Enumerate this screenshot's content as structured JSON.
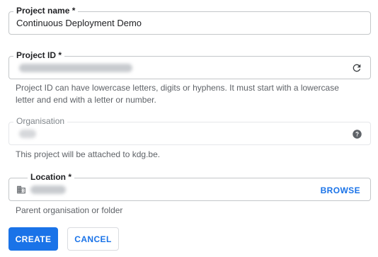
{
  "project_name": {
    "label": "Project name *",
    "value": "Continuous Deployment Demo"
  },
  "project_id": {
    "label": "Project ID *",
    "refresh_icon": "refresh-icon",
    "helper_line1": "Project ID can have lowercase letters, digits or hyphens. It must start with a lowercase",
    "helper_line2": "letter and end with a letter or number."
  },
  "organisation": {
    "label": "Organisation",
    "help_icon": "help-icon",
    "helper": "This project will be attached to kdg.be."
  },
  "location": {
    "label": "Location *",
    "location_icon": "building-icon",
    "browse_label": "BROWSE",
    "helper": "Parent organisation or folder"
  },
  "actions": {
    "create_label": "CREATE",
    "cancel_label": "CANCEL"
  },
  "colors": {
    "primary": "#1a73e8",
    "border": "#c4c7c9",
    "helper_text": "#5f6368"
  }
}
